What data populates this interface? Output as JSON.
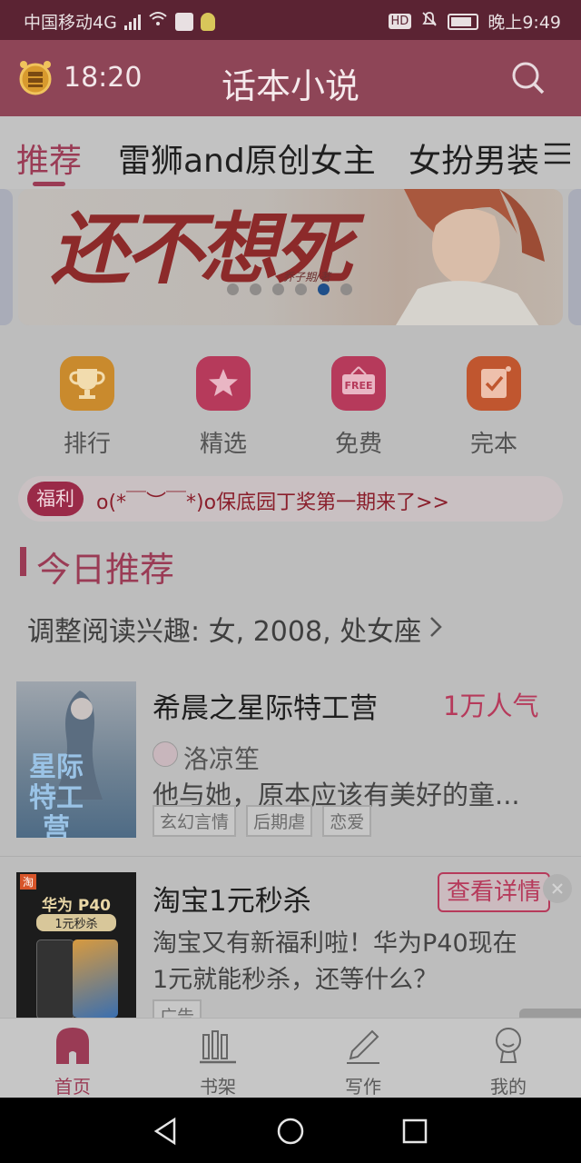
{
  "status_bar": {
    "carrier": "中国移动4G",
    "network": "4G",
    "hd_badge": "HD",
    "time": "晚上9:49"
  },
  "header": {
    "clock_time": "18:20",
    "title": "话本小说"
  },
  "tabs": [
    {
      "label": "推荐",
      "active": true
    },
    {
      "label": "雷狮and原创女主",
      "active": false
    },
    {
      "label": "女扮男装",
      "active": false
    }
  ],
  "banner": {
    "title": "还不想死",
    "author": "乔子期/著",
    "dots": 6,
    "active_dot": 5
  },
  "features": [
    {
      "label": "排行",
      "icon": "trophy-icon",
      "color": "#c98a2d"
    },
    {
      "label": "精选",
      "icon": "star-icon",
      "color": "#b63a5b"
    },
    {
      "label": "免费",
      "icon": "free-sign-icon",
      "color": "#b63a5b"
    },
    {
      "label": "完本",
      "icon": "checklist-icon",
      "color": "#c0562f"
    }
  ],
  "welfare": {
    "badge": "福利",
    "text": "o(*￣︶￣*)o保底园丁奖第一期来了>>"
  },
  "section": {
    "title": "今日推荐",
    "interest": "调整阅读兴趣: 女, 2008, 处女座"
  },
  "books": [
    {
      "title": "希晨之星际特工营",
      "popularity": "1万人气",
      "author": "洛凉笙",
      "summary": "他与她，原本应该有美好的童...",
      "tags": [
        "玄幻言情",
        "后期虐",
        "恋爱"
      ],
      "cover_text": "星际特工营"
    }
  ],
  "ad": {
    "title": "淘宝1元秒杀",
    "cta": "查看详情",
    "line1": "淘宝又有新福利啦！华为P40现在",
    "line2": "1元就能秒杀，还等什么？",
    "tag": "广告",
    "cover_text1": "华为 P40",
    "cover_text2": "1元秒杀",
    "taobao_badge": "淘"
  },
  "bottom_nav": [
    {
      "label": "首页",
      "icon": "home-icon",
      "active": true
    },
    {
      "label": "书架",
      "icon": "bookshelf-icon",
      "active": false
    },
    {
      "label": "写作",
      "icon": "pen-icon",
      "active": false
    },
    {
      "label": "我的",
      "icon": "profile-icon",
      "active": false
    }
  ],
  "colors": {
    "accent": "#b63a5b",
    "header": "#8e4557",
    "status": "#5b2333"
  }
}
